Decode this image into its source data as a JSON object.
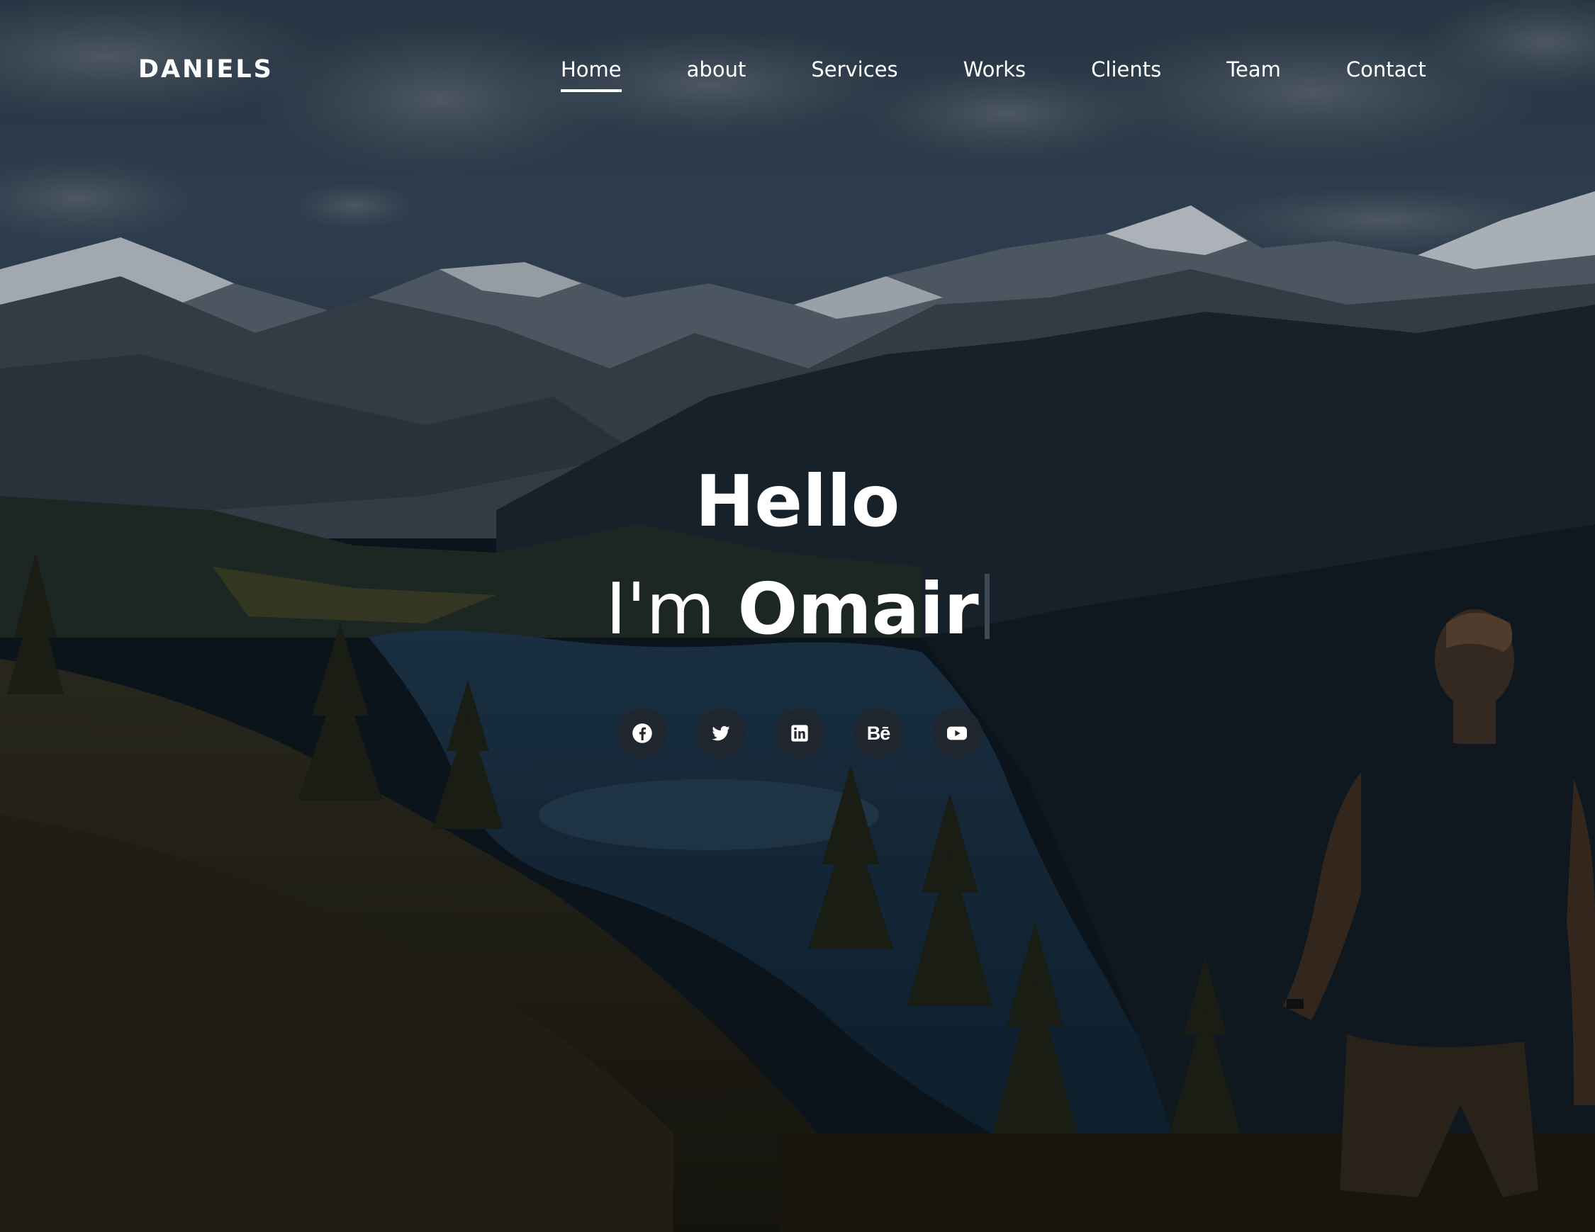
{
  "header": {
    "logo": "DANIELS",
    "nav": [
      "Home",
      "about",
      "Services",
      "Works",
      "Clients",
      "Team",
      "Contact"
    ],
    "active_nav": "Home"
  },
  "hero": {
    "greeting": "Hello",
    "intro_prefix": "I'm",
    "intro_name": "Omair"
  },
  "social": {
    "icons": [
      "facebook-icon",
      "twitter-icon",
      "linkedin-icon",
      "behance-icon",
      "youtube-icon"
    ],
    "behance_glyph": "Bē"
  },
  "colors": {
    "text": "#ffffff",
    "social_bg": "#22262c",
    "cursor": "#3b4a56"
  }
}
